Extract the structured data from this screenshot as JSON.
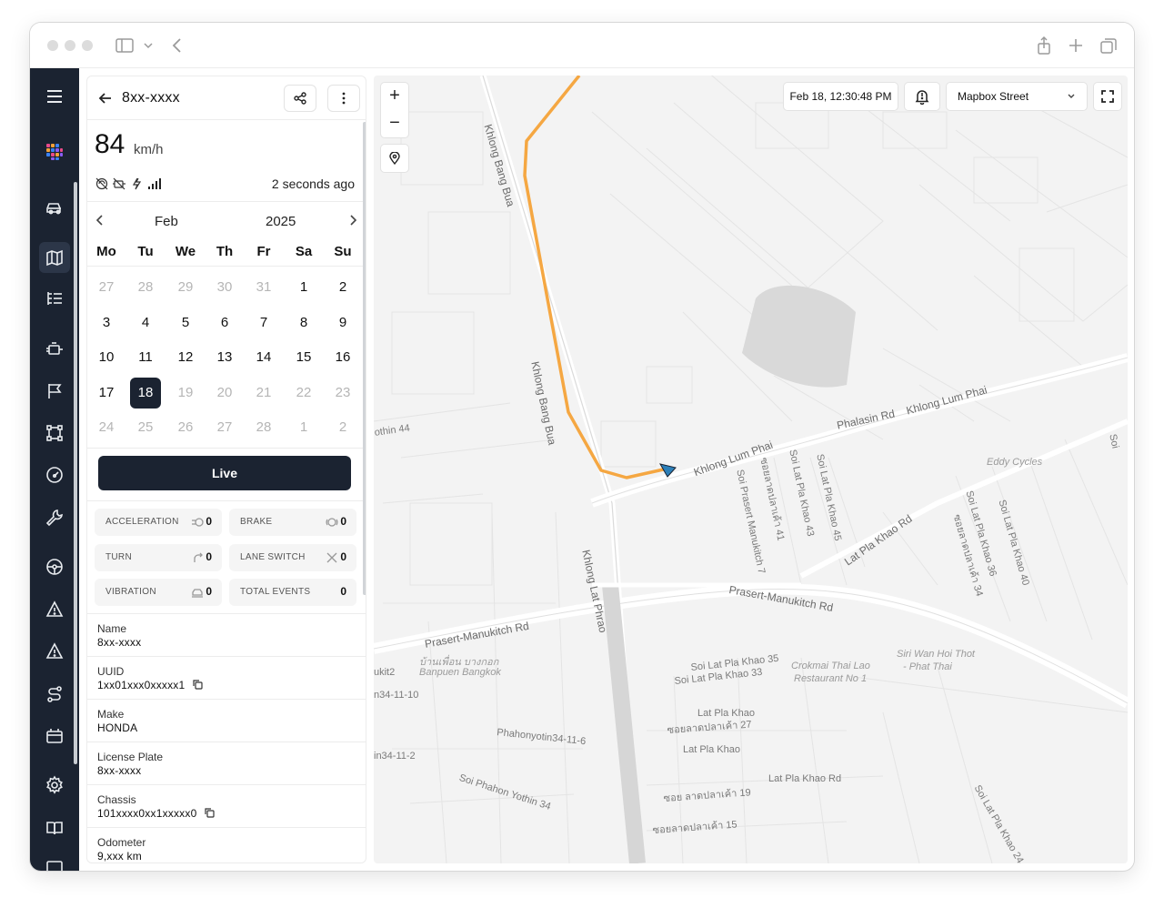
{
  "vehicle": {
    "title": "8xx-xxxx",
    "speed_value": "84",
    "speed_unit": "km/h",
    "last_update": "2 seconds ago",
    "status_icons": [
      "ignition-off-icon",
      "engine-off-icon",
      "charging-icon",
      "signal-bars-icon"
    ]
  },
  "calendar": {
    "month": "Feb",
    "year": "2025",
    "weekdays": [
      "Mo",
      "Tu",
      "We",
      "Th",
      "Fr",
      "Sa",
      "Su"
    ],
    "weeks": [
      [
        {
          "d": "27",
          "m": true
        },
        {
          "d": "28",
          "m": true
        },
        {
          "d": "29",
          "m": true
        },
        {
          "d": "30",
          "m": true
        },
        {
          "d": "31",
          "m": true
        },
        {
          "d": "1",
          "m": false
        },
        {
          "d": "2",
          "m": false
        }
      ],
      [
        {
          "d": "3",
          "m": false
        },
        {
          "d": "4",
          "m": false
        },
        {
          "d": "5",
          "m": false
        },
        {
          "d": "6",
          "m": false
        },
        {
          "d": "7",
          "m": false
        },
        {
          "d": "8",
          "m": false
        },
        {
          "d": "9",
          "m": false
        }
      ],
      [
        {
          "d": "10",
          "m": false
        },
        {
          "d": "11",
          "m": false
        },
        {
          "d": "12",
          "m": false
        },
        {
          "d": "13",
          "m": false
        },
        {
          "d": "14",
          "m": false
        },
        {
          "d": "15",
          "m": false
        },
        {
          "d": "16",
          "m": false
        }
      ],
      [
        {
          "d": "17",
          "m": false
        },
        {
          "d": "18",
          "m": false,
          "sel": true
        },
        {
          "d": "19",
          "m": true
        },
        {
          "d": "20",
          "m": true
        },
        {
          "d": "21",
          "m": true
        },
        {
          "d": "22",
          "m": true
        },
        {
          "d": "23",
          "m": true
        }
      ],
      [
        {
          "d": "24",
          "m": true
        },
        {
          "d": "25",
          "m": true
        },
        {
          "d": "26",
          "m": true
        },
        {
          "d": "27",
          "m": true
        },
        {
          "d": "28",
          "m": true
        },
        {
          "d": "1",
          "m": true
        },
        {
          "d": "2",
          "m": true
        }
      ]
    ]
  },
  "live_button": "Live",
  "events": [
    {
      "label": "ACCELERATION",
      "value": "0",
      "icon": "acceleration-icon"
    },
    {
      "label": "BRAKE",
      "value": "0",
      "icon": "brake-icon"
    },
    {
      "label": "TURN",
      "value": "0",
      "icon": "turn-icon"
    },
    {
      "label": "LANE SWITCH",
      "value": "0",
      "icon": "lane-switch-icon"
    },
    {
      "label": "VIBRATION",
      "value": "0",
      "icon": "vibration-icon"
    },
    {
      "label": "TOTAL EVENTS",
      "value": "0"
    }
  ],
  "fields": [
    {
      "label": "Name",
      "value": "8xx-xxxx"
    },
    {
      "label": "UUID",
      "value": "1xx01xxx0xxxxx1",
      "copy": true
    },
    {
      "label": "Make",
      "value": "HONDA"
    },
    {
      "label": "License Plate",
      "value": "8xx-xxxx"
    },
    {
      "label": "Chassis",
      "value": "101xxxx0xx1xxxxx0",
      "copy": true
    },
    {
      "label": "Odometer",
      "value": "9,xxx km"
    }
  ],
  "map": {
    "timestamp": "Feb 18, 12:30:48 PM",
    "style_select": "Mapbox Street",
    "zoom_in": "+",
    "zoom_out": "−",
    "route_color": "#f5a742",
    "labels": [
      {
        "text": "Khlong Bang Bua"
      },
      {
        "text": "Khlong Bang Bua"
      },
      {
        "text": "Phalasin Rd"
      },
      {
        "text": "Khlong Lum Phai"
      },
      {
        "text": "Khlong Lum Phai"
      },
      {
        "text": "Soi Lat Pla Khao 45"
      },
      {
        "text": "Soi Lat Pla Khao 43"
      },
      {
        "text": "ซอยลาดปลาเค้า 41"
      },
      {
        "text": "Soi Prasert Manukitch 7"
      },
      {
        "text": "Lat Pla Khao Rd"
      },
      {
        "text": "Eddy Cycles"
      },
      {
        "text": "Soi Lat Pla Khao 36"
      },
      {
        "text": "ซอยลาดปลาเค้า 34"
      },
      {
        "text": "Soi Lat Pla Khao 40"
      },
      {
        "text": "Khlong Lat Phrao"
      },
      {
        "text": "Prasert-Manukitch Rd"
      },
      {
        "text": "Prasert-Manukitch Rd"
      },
      {
        "text": "othin 44"
      },
      {
        "text": "บ้านเพื่อน บางกอก"
      },
      {
        "text": "Banpuen Bangkok"
      },
      {
        "text": "ukit2"
      },
      {
        "text": "n34-11-10"
      },
      {
        "text": "Soi Lat Pla Khao 35"
      },
      {
        "text": "Soi Lat Pla Khao 33"
      },
      {
        "text": "Crokmai Thai Lao"
      },
      {
        "text": "Restaurant No 1"
      },
      {
        "text": "Siri Wan Hoi Thot"
      },
      {
        "text": "- Phat Thai"
      },
      {
        "text": "Lat Pla Khao"
      },
      {
        "text": "ซอยลาดปลาเค้า 27"
      },
      {
        "text": "Phahonyotin34-11-6"
      },
      {
        "text": "Lat Pla Khao"
      },
      {
        "text": "in34-11-2"
      },
      {
        "text": "Lat Pla Khao Rd"
      },
      {
        "text": "Soi Phahon Yothin 34"
      },
      {
        "text": "ซอย ลาดปลาเค้า 19"
      },
      {
        "text": "ซอยลาดปลาเค้า 15"
      },
      {
        "text": "Soi Lat Pla Khao 24"
      },
      {
        "text": "Soi"
      }
    ]
  }
}
